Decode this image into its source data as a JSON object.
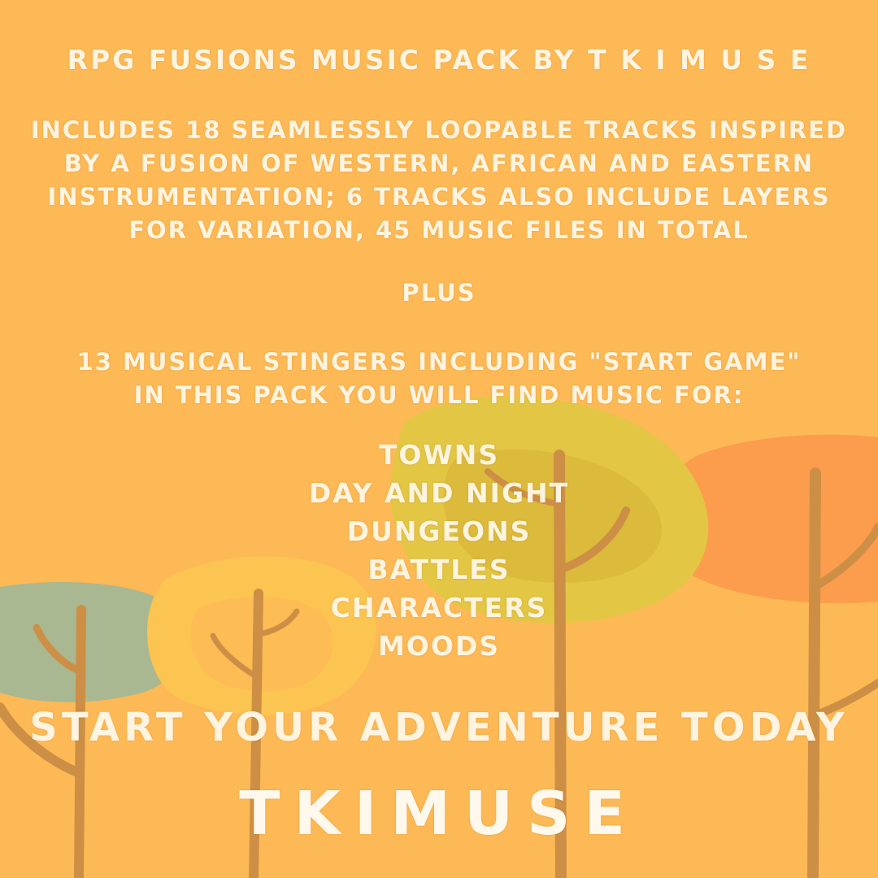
{
  "title": "RPG Fusions Music Pack by T K I M U S E",
  "description_lines": [
    "Includes 18 seamlessly loopable tracks inspired",
    "by a fusion of Western, African and Eastern",
    "instrumentation; 6 tracks also include layers",
    "for variation, 45 music files in total"
  ],
  "plus": "Plus",
  "stinger_lines": [
    "13 musical stingers including \"start game\"",
    "in this pack you will find music for:"
  ],
  "categories": [
    "Towns",
    "Day and Night",
    "Dungeons",
    "Battles",
    "Characters",
    "Moods"
  ],
  "cta": "Start your adventure today",
  "brand": "TKIMUSE",
  "colors": {
    "background": "#fdb955",
    "text": "#fff4df",
    "trunk": "#cc8f45",
    "canopy_green": "#a9b891",
    "canopy_yellow": "#fcc451",
    "canopy_olive": "#e2c644",
    "canopy_orange": "#fb9d4c"
  }
}
